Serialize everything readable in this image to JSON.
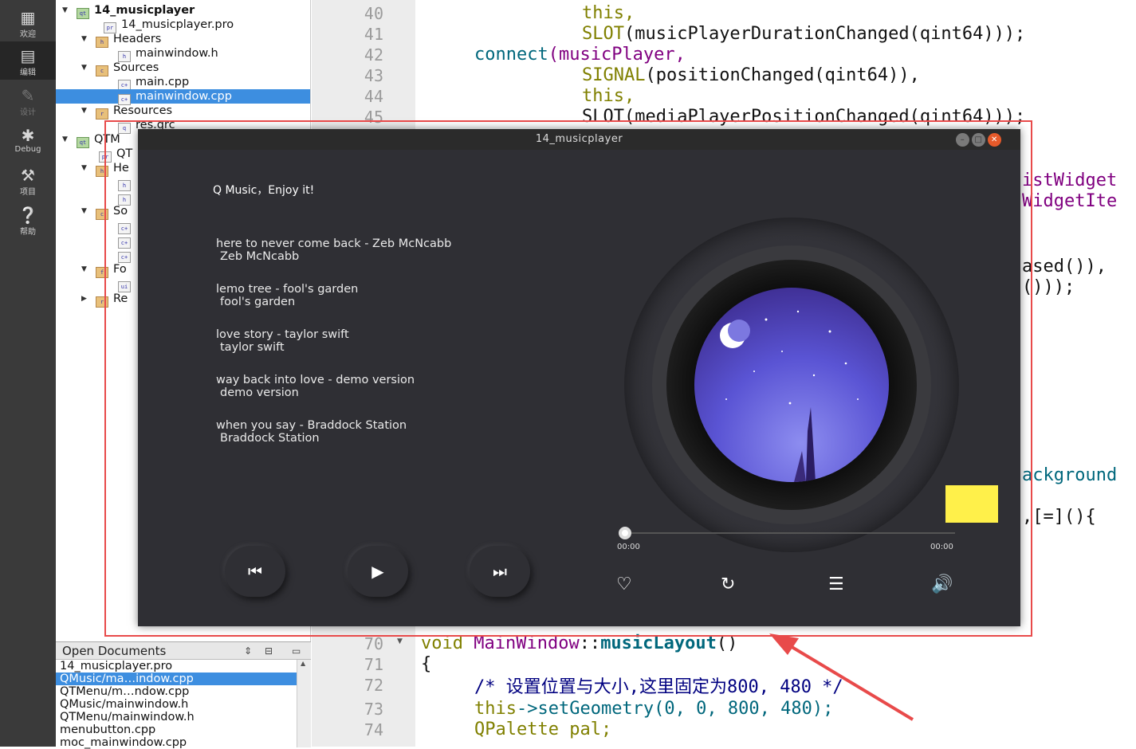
{
  "modebar": [
    {
      "icon": "grid-icon",
      "label": "欢迎",
      "active": false,
      "dim": false
    },
    {
      "icon": "edit-icon",
      "label": "编辑",
      "active": true,
      "dim": false
    },
    {
      "icon": "pencil-icon",
      "label": "设计",
      "active": false,
      "dim": true
    },
    {
      "icon": "bug-icon",
      "label": "Debug",
      "active": false,
      "dim": false
    },
    {
      "icon": "wrench-icon",
      "label": "项目",
      "active": false,
      "dim": false
    },
    {
      "icon": "help-icon",
      "label": "帮助",
      "active": false,
      "dim": false
    }
  ],
  "tree": {
    "project": "14_musicplayer",
    "pro_file": "14_musicplayer.pro",
    "headers": "Headers",
    "mainwindow_h": "mainwindow.h",
    "sources": "Sources",
    "main_cpp": "main.cpp",
    "mainwindow_cpp": "mainwindow.cpp",
    "resources": "Resources",
    "res_qrc": "res.qrc",
    "qtm": "QTM",
    "qt": "QT",
    "he": "He",
    "so": "So",
    "fo": "Fo",
    "re": "Re"
  },
  "opendocs": {
    "title": "Open Documents",
    "items": [
      {
        "name": "14_musicplayer.pro",
        "selected": false
      },
      {
        "name": "QMusic/ma…indow.cpp",
        "selected": true
      },
      {
        "name": "QTMenu/m…ndow.cpp",
        "selected": false
      },
      {
        "name": "QMusic/mainwindow.h",
        "selected": false
      },
      {
        "name": "QTMenu/mainwindow.h",
        "selected": false
      },
      {
        "name": "menubutton.cpp",
        "selected": false
      },
      {
        "name": "moc_mainwindow.cpp",
        "selected": false
      }
    ]
  },
  "editor": {
    "line_numbers": [
      "40",
      "41",
      "42",
      "43",
      "44",
      "45",
      "70",
      "71",
      "72",
      "73",
      "74"
    ],
    "right_fragments": [
      "istWidget",
      "WidgetIte",
      "ased()),",
      "()));",
      "ackground",
      ",[=](){"
    ],
    "line40": "this,",
    "line41_fn": "SLOT",
    "line41_rest": "(musicPlayerDurationChanged(qint64)));",
    "line42_fn": "connect",
    "line42_rest": "(musicPlayer,",
    "line43_fn": "SIGNAL",
    "line43_rest": "(positionChanged(qint64)),",
    "line44": "this,",
    "line45": "SLOT(mediaPlayerPositionChanged(qint64)));",
    "line70_kw": "void",
    "line70_cls": "MainWindow",
    "line70_sep": "::",
    "line70_fn": "musicLayout",
    "line70_end": "()",
    "line71": "{",
    "line72": "/* 设置位置与大小,这里固定为800, 480 */",
    "line73_kw": "this",
    "line73_rest": "->setGeometry(0, 0, 800, 480);",
    "line74": "QPalette pal;"
  },
  "player": {
    "window_title": "14_musicplayer",
    "slogan": "Q Music，Enjoy it!",
    "songs": [
      {
        "title": "here to never come back - Zeb McNcabb",
        "artist": "Zeb McNcabb"
      },
      {
        "title": "lemo tree - fool's garden",
        "artist": "fool's garden"
      },
      {
        "title": "love story - taylor swift",
        "artist": "taylor swift"
      },
      {
        "title": "way back into love - demo version",
        "artist": "demo version"
      },
      {
        "title": "when you say - Braddock Station",
        "artist": "Braddock Station"
      }
    ],
    "current_time": "00:00",
    "total_time": "00:00",
    "progress": 0,
    "controls": {
      "prev": "previous-icon",
      "play": "play-icon",
      "next": "next-icon"
    },
    "actions": [
      "heart-icon",
      "repeat-icon",
      "playlist-icon",
      "volume-icon"
    ]
  },
  "colors": {
    "accent_selection": "#3d8ee0",
    "highlight_border": "#e84a4a",
    "player_bg": "#2f2f34",
    "yellow_box": "#fff04a"
  }
}
